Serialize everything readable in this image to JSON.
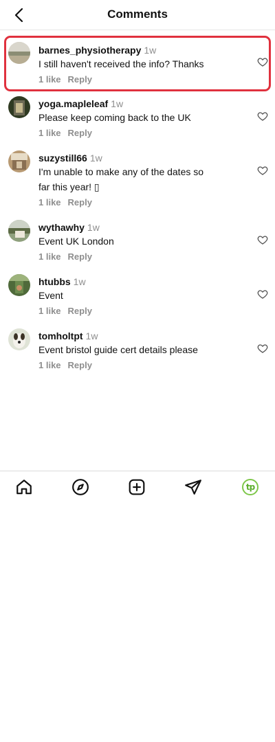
{
  "header": {
    "title": "Comments"
  },
  "comments": [
    {
      "username": "barnes_physiotherapy",
      "time": "1w",
      "text": "I still haven't received the info? Thanks",
      "likes": "1 like",
      "reply": "Reply"
    },
    {
      "username": "yoga.mapleleaf",
      "time": "1w",
      "text": "Please keep coming back to the UK",
      "likes": "1 like",
      "reply": "Reply"
    },
    {
      "username": "suzystill66",
      "time": "1w",
      "text_line1": "I'm unable to make any of the dates so",
      "text_line2": "far this year! ▯",
      "likes": "1 like",
      "reply": "Reply"
    },
    {
      "username": "wythawhy",
      "time": "1w",
      "text": "Event UK London",
      "likes": "1 like",
      "reply": "Reply"
    },
    {
      "username": "htubbs",
      "time": "1w",
      "text": "Event",
      "likes": "1 like",
      "reply": "Reply"
    },
    {
      "username": "tomholtpt",
      "time": "1w",
      "text": "Event bristol guide cert details please",
      "likes": "1 like",
      "reply": "Reply"
    }
  ],
  "tabbar": {
    "profile_initials": "tp"
  },
  "colors": {
    "highlight": "#e0313e",
    "profile_ring": "#7ec74a"
  }
}
